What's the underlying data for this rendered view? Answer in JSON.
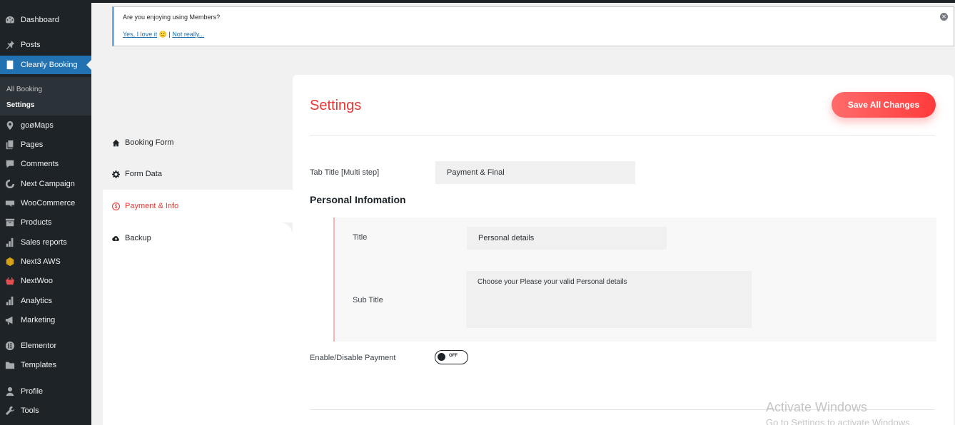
{
  "sidebar": {
    "items": [
      {
        "label": "Dashboard",
        "icon": "dashboard-icon"
      },
      {
        "label": "Posts",
        "icon": "pin-icon"
      },
      {
        "label": "Cleanly Booking",
        "icon": "document-icon"
      },
      {
        "label": "goøMaps",
        "icon": "location-pin-icon"
      },
      {
        "label": "Pages",
        "icon": "pages-icon"
      },
      {
        "label": "Comments",
        "icon": "comment-icon"
      },
      {
        "label": "Next Campaign",
        "icon": "campaign-icon"
      },
      {
        "label": "WooCommerce",
        "icon": "woo-icon"
      },
      {
        "label": "Products",
        "icon": "archive-icon"
      },
      {
        "label": "Sales reports",
        "icon": "bar-chart-icon"
      },
      {
        "label": "Next3 AWS",
        "icon": "aws-icon"
      },
      {
        "label": "NextWoo",
        "icon": "basket-icon"
      },
      {
        "label": "Analytics",
        "icon": "bar-chart-icon"
      },
      {
        "label": "Marketing",
        "icon": "megaphone-icon"
      },
      {
        "label": "Elementor",
        "icon": "elementor-icon"
      },
      {
        "label": "Templates",
        "icon": "folder-icon"
      },
      {
        "label": "Profile",
        "icon": "user-icon"
      },
      {
        "label": "Tools",
        "icon": "wrench-icon"
      }
    ],
    "submenu": [
      {
        "label": "All Booking"
      },
      {
        "label": "Settings"
      }
    ]
  },
  "notice": {
    "question": "Are you enjoying using Members?",
    "yes_label": "Yes, I love it",
    "emoji": "🙂",
    "separator": "|",
    "no_label": "Not really..."
  },
  "tabs": [
    {
      "label": "Booking Form",
      "icon": "home-icon"
    },
    {
      "label": "Form Data",
      "icon": "gear-icon"
    },
    {
      "label": "Payment & Info",
      "icon": "dollar-icon"
    },
    {
      "label": "Backup",
      "icon": "cloud-icon"
    }
  ],
  "panel": {
    "title": "Settings",
    "save_label": "Save All Changes",
    "tab_title_label": "Tab Title [Multi step]",
    "tab_title_value": "Payment & Final",
    "personal_heading": "Personal Infomation",
    "title_label": "Title",
    "title_value": "Personal details",
    "subtitle_label": "Sub Title",
    "subtitle_value": "Choose your Please your valid Personal details",
    "payment_label": "Enable/Disable Payment",
    "toggle_state": "OFF"
  },
  "watermark": {
    "line1": "Activate Windows",
    "line2": "Go to Settings to activate Windows."
  },
  "colors": {
    "accent_red": "#e53935",
    "wp_blue": "#2271b1",
    "sidebar_bg": "#1d2327"
  }
}
